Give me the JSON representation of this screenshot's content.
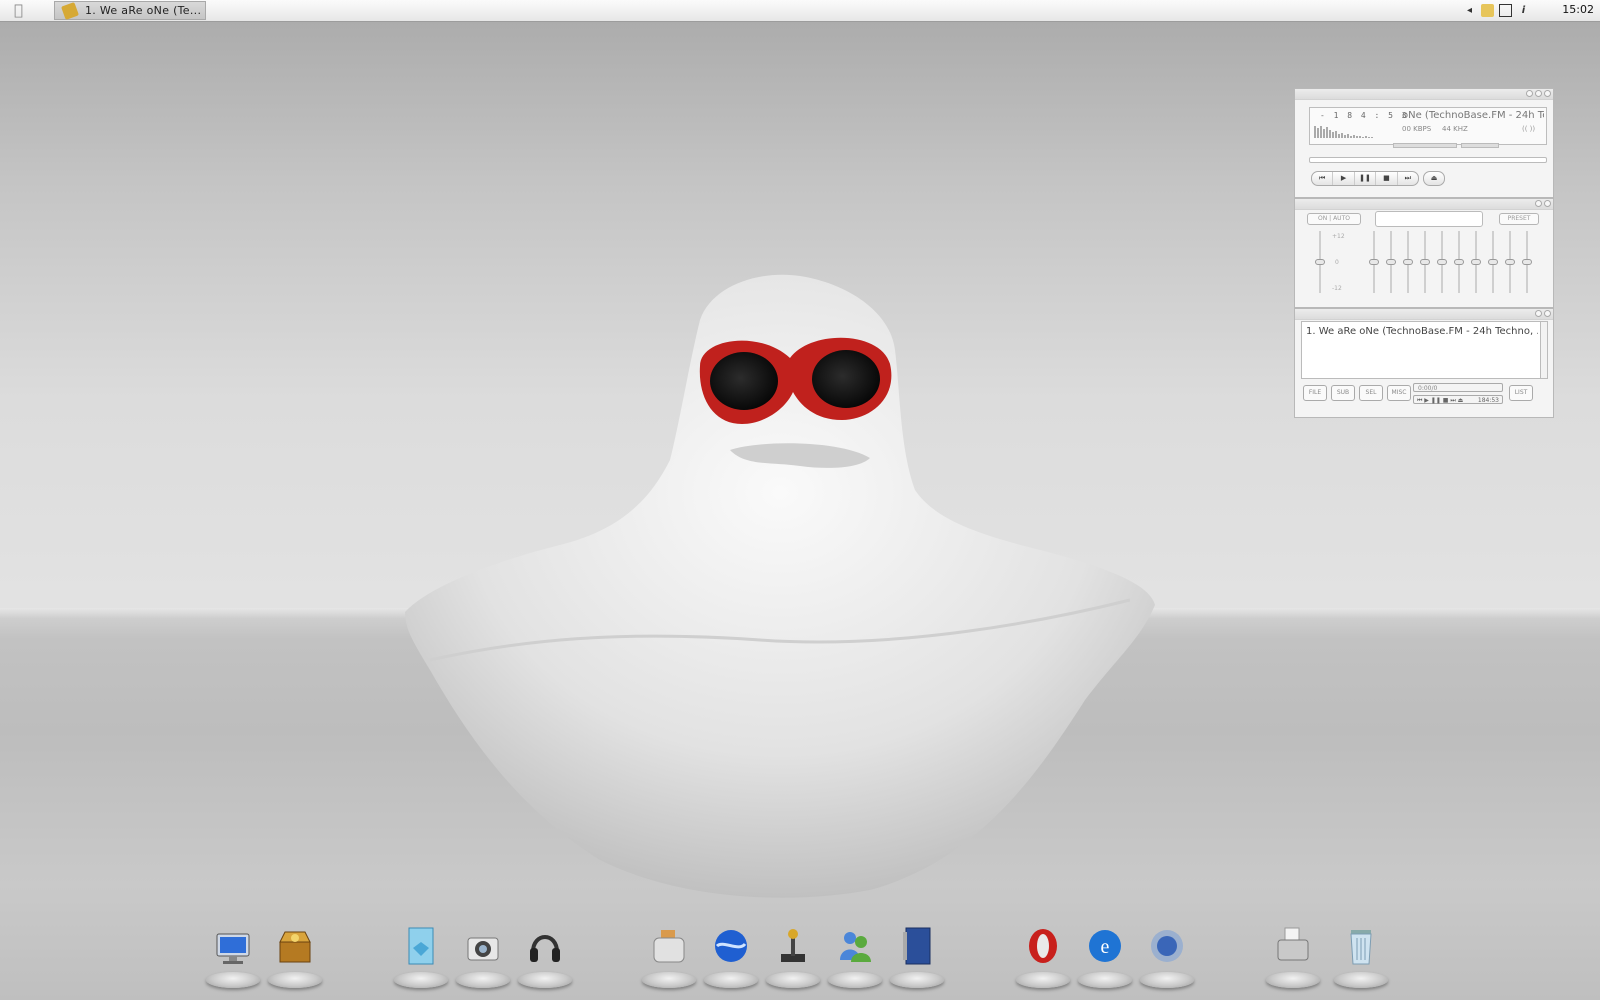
{
  "menubar": {
    "apple_icon": "apple-logo-icon",
    "task_button": {
      "icon": "winamp-icon",
      "label": "1. We aRe oNe (Te..."
    },
    "tray_icons": [
      "tray-arrow-icon",
      "shield-icon",
      "display-icon",
      "info-icon"
    ],
    "clock": "15:02"
  },
  "player": {
    "main": {
      "time_display": "- 1 8 4 : 5 3",
      "marquee": "oNe (TechnoBase.FM - 24h Techno",
      "kbps": "00 KBPS",
      "khz": "44 KHZ",
      "stereo": "(( )) ",
      "controls": [
        "⏮",
        "▶",
        "❚❚",
        "■",
        "⏭"
      ],
      "eject": "⏏"
    },
    "equalizer": {
      "on_auto": "ON | AUTO",
      "presets": "PRESET",
      "db_top": "+12",
      "db_mid": "0",
      "db_bottom": "-12"
    },
    "playlist": {
      "items": [
        "1. We aRe oNe (TechnoBase.FM - 24h Techno, ..."
      ],
      "buttons": [
        "FILE",
        "SUB",
        "SEL",
        "MISC",
        "LIST"
      ],
      "time": "0:00/0",
      "length": "184:53"
    }
  },
  "dock": {
    "items": [
      {
        "name": "my-computer-icon",
        "color": "#2f6ed8"
      },
      {
        "name": "treasure-chest-icon",
        "color": "#c9962a"
      },
      {
        "name": "windows-media-icon",
        "color": "#4aa7d6"
      },
      {
        "name": "camera-icon",
        "color": "#9a9a9a"
      },
      {
        "name": "headphones-icon",
        "color": "#333333"
      },
      {
        "name": "toaster-icon",
        "color": "#c8c8c8"
      },
      {
        "name": "google-earth-icon",
        "color": "#1f5fd1"
      },
      {
        "name": "joystick-icon",
        "color": "#d8a72a"
      },
      {
        "name": "messenger-icon",
        "color": "#5aaa3e"
      },
      {
        "name": "address-book-icon",
        "color": "#2b4f9a"
      },
      {
        "name": "opera-icon",
        "color": "#c8201c"
      },
      {
        "name": "internet-explorer-icon",
        "color": "#1f74d4"
      },
      {
        "name": "thunderbird-icon",
        "color": "#3a66b8"
      },
      {
        "name": "printer-icon",
        "color": "#bdbdbd"
      },
      {
        "name": "trash-icon",
        "color": "#9cc4de"
      }
    ]
  }
}
